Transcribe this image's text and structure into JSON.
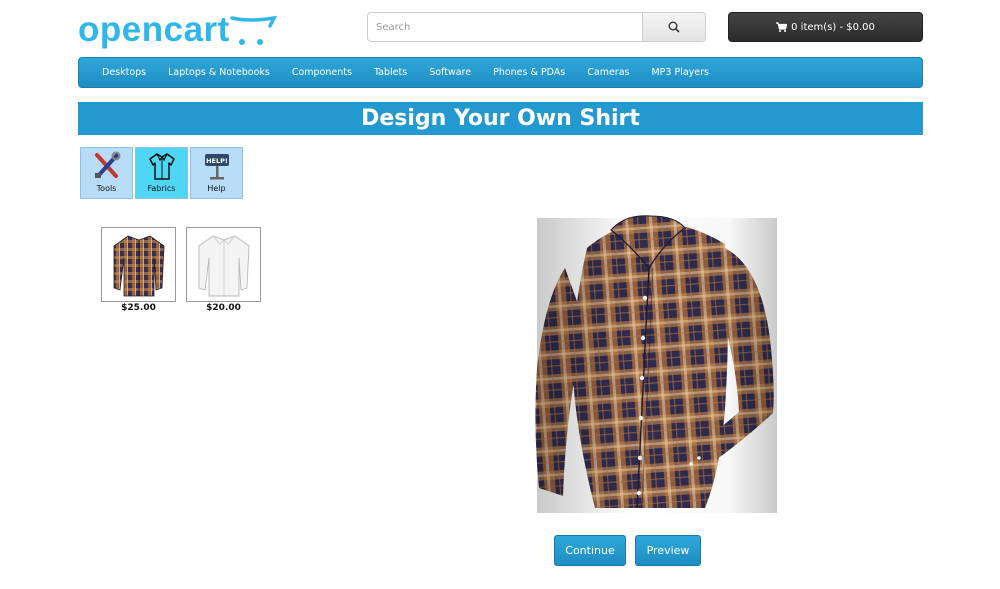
{
  "header": {
    "logo_text": "opencart",
    "search_placeholder": "Search",
    "cart_label": "0 item(s) - $0.00"
  },
  "nav": {
    "items": [
      "Desktops",
      "Laptops & Notebooks",
      "Components",
      "Tablets",
      "Software",
      "Phones & PDAs",
      "Cameras",
      "MP3 Players"
    ]
  },
  "page": {
    "title": "Design Your Own Shirt"
  },
  "toolbox": {
    "tabs": [
      {
        "label": "Tools",
        "icon": "tools-icon",
        "active": false
      },
      {
        "label": "Fabrics",
        "icon": "shirt-icon",
        "active": true
      },
      {
        "label": "Help",
        "icon": "help-sign-icon",
        "active": false
      }
    ]
  },
  "fabrics": [
    {
      "name": "plaid-shirt",
      "price": "$25.00"
    },
    {
      "name": "white-shirt",
      "price": "$20.00"
    }
  ],
  "actions": {
    "continue_label": "Continue",
    "preview_label": "Preview"
  },
  "colors": {
    "accent": "#2499cf",
    "logo": "#2eb7e8",
    "active_tab": "#4ed6f4",
    "tab": "#b8dcf5"
  }
}
